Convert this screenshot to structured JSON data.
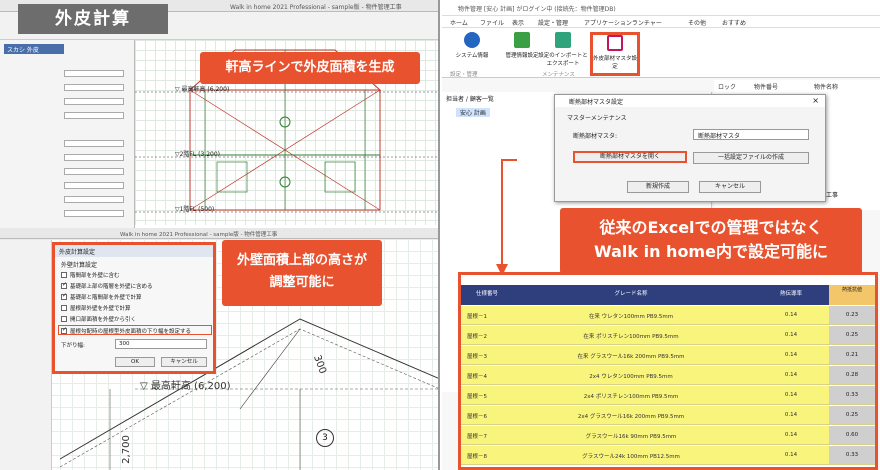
{
  "left": {
    "title_tag": "外皮計算",
    "callout_eave": "軒高ラインで外皮面積を生成",
    "callout_wall_1": "外壁面積上部の高さが",
    "callout_wall_2": "調整可能に",
    "cad_title": "Walk in home 2021 Professional - sample版 - 物件管理工事",
    "prop_title": "スカシ 外皮",
    "dims": {
      "top_eave": "▽ 最高軒高 (6,200)",
      "floor2": "▽2階FL (3,200)",
      "floor1": "▽1階FL (500)",
      "bottom_eave": "▽ 最高軒高 (6,200)",
      "label_300": "300",
      "label_2700": "2,700",
      "circle_3": "3"
    },
    "dialog": {
      "title": "外皮計算設定",
      "section": "外壁計算設定",
      "items": [
        "階間部を外壁に含む",
        "基礎部上部の階層を外壁に含める",
        "基礎部と階間部を外壁で計算",
        "屋根部外壁を外壁で計算",
        "開口部面積を外壁から引く",
        "屋根勾配時の屋根型外皮面積の下り幅を設定する"
      ],
      "select_label": "下がり幅:",
      "select_value": "300",
      "ok": "OK",
      "cancel": "キャンセル"
    }
  },
  "right": {
    "window_title": "物件管理 [安心 計画] がログイン中 (接続先：物件管理DB)",
    "menu": [
      "ホーム",
      "ファイル",
      "表示",
      "設定・管理",
      "アプリケーションランチャー",
      "その他",
      "おすすめ"
    ],
    "ribbon": {
      "system_info": "システム情報",
      "admin_settings": "管理情報設定",
      "import_export": "設定のインポートとエクスポート",
      "master_settings": "外皮部材マスタ設定",
      "group_1": "設定・管理",
      "group_2": "メンテナンス"
    },
    "tree_header": "担当者 / 顧客一覧",
    "tree_item": "安心 計画",
    "grid_headers": [
      "ロック",
      "物件番号",
      "物件名称"
    ],
    "grid_cell": "部材工事",
    "dialog": {
      "title": "断熱部材マスタ設定",
      "section": "マスターメンテナンス",
      "master_label": "断熱部材マスタ:",
      "master_value": "断熱部材マスタ",
      "open_button": "断熱部材マスタを開く",
      "create_file_button": "一括設定ファイルの作成",
      "new_button": "新規作成",
      "cancel_button": "キャンセル"
    },
    "callout_excel_1": "従来のExcelでの管理ではなく",
    "callout_excel_2": "Walk in home内で設定可能に",
    "table": {
      "headers": [
        "仕様番号",
        "グレード名称",
        "熱伝導率",
        "熱抵抗値"
      ],
      "rows": [
        {
          "id": "屋根－1",
          "name": "在来 ウレタン100mm PB9.5mm",
          "v1": "0.14",
          "v2": "0.23"
        },
        {
          "id": "屋根－2",
          "name": "在来 ポリスチレン100mm PB9.5mm",
          "v1": "0.14",
          "v2": "0.25"
        },
        {
          "id": "屋根－3",
          "name": "在来 グラスウール16k 200mm PB9.5mm",
          "v1": "0.14",
          "v2": "0.21"
        },
        {
          "id": "屋根－4",
          "name": "2x4 ウレタン100mm PB9.5mm",
          "v1": "0.14",
          "v2": "0.28"
        },
        {
          "id": "屋根－5",
          "name": "2x4 ポリスチレン100mm PB9.5mm",
          "v1": "0.14",
          "v2": "0.33"
        },
        {
          "id": "屋根－6",
          "name": "2x4 グラスウール16k 200mm PB9.5mm",
          "v1": "0.14",
          "v2": "0.25"
        },
        {
          "id": "屋根－7",
          "name": "グラスウール16k 90mm PB9.5mm",
          "v1": "0.14",
          "v2": "0.60"
        },
        {
          "id": "屋根－8",
          "name": "グラスウール24k 100mm PB12.5mm",
          "v1": "0.14",
          "v2": "0.33"
        }
      ]
    }
  }
}
